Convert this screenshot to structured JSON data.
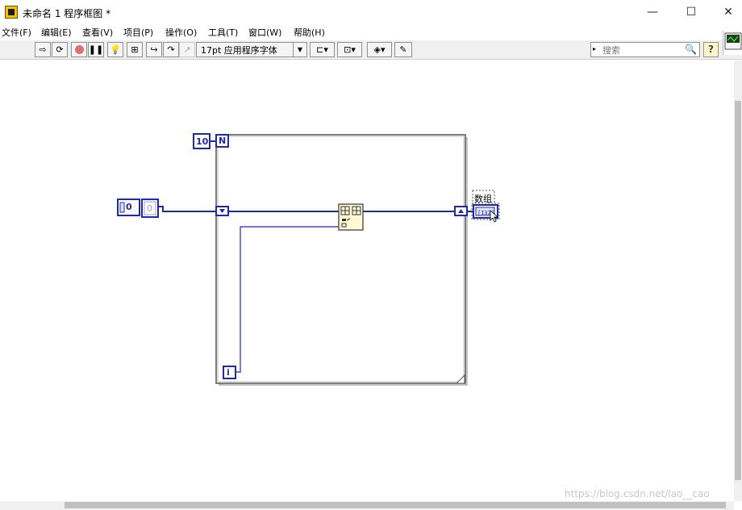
{
  "window": {
    "title": "未命名 1 程序框图 *",
    "minimize": "—",
    "maximize": "☐",
    "close": "✕"
  },
  "menu": [
    {
      "label": "文件(F)"
    },
    {
      "label": "编辑(E)"
    },
    {
      "label": "查看(V)"
    },
    {
      "label": "项目(P)"
    },
    {
      "label": "操作(O)"
    },
    {
      "label": "工具(T)"
    },
    {
      "label": "窗口(W)"
    },
    {
      "label": "帮助(H)"
    }
  ],
  "toolbar": {
    "font_select": "17pt 应用程序字体",
    "search_placeholder": "搜索",
    "help": "?"
  },
  "diagram": {
    "count_constant": "10",
    "count_terminal": "N",
    "iteration_terminal": "i",
    "initial_value": "0",
    "array_initial": "0",
    "indicator_label": "数组"
  },
  "watermark": "https://blog.csdn.net/lao__cao"
}
